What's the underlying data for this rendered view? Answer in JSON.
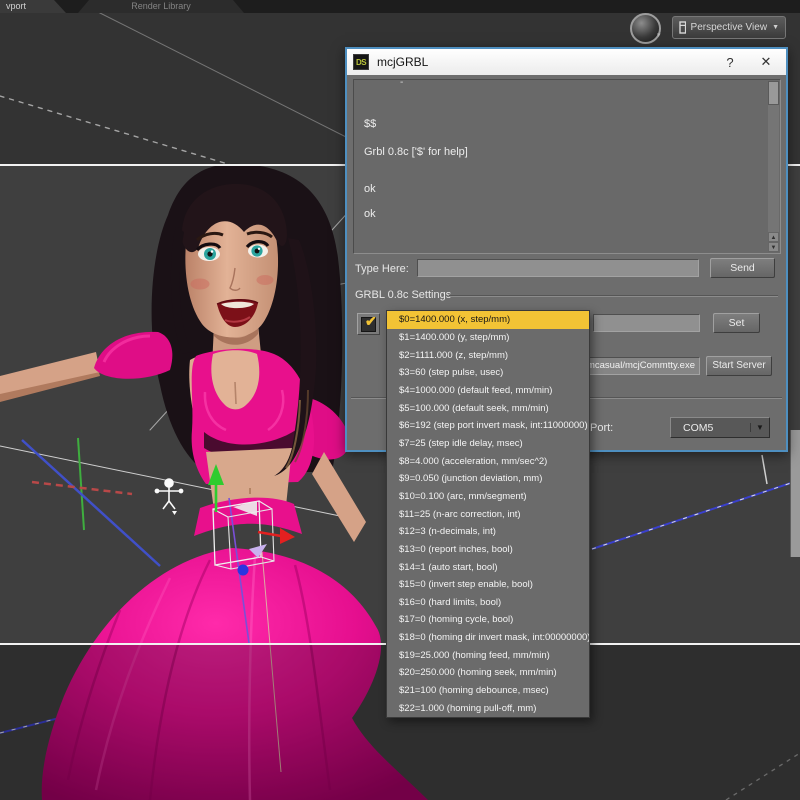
{
  "window": {
    "tabs": [
      {
        "label": "vport",
        "active": true
      },
      {
        "label": "Render Library",
        "active": false
      }
    ],
    "view_selector": {
      "label": "Perspective View",
      "arrow": "▼"
    },
    "magnifier_arrow": "▾"
  },
  "dialog": {
    "logo": "DS",
    "title": "mcjGRBL",
    "help": "?",
    "close": "✕",
    "console": {
      "partial_line": "-",
      "lines": [
        "$$",
        "Grbl 0.8c ['$' for help]",
        "ok",
        "ok"
      ]
    },
    "scrollbar": {
      "up": "▲",
      "down": "▼"
    },
    "prompt": {
      "label": "Type Here:",
      "value": "",
      "send": "Send"
    },
    "settings_group": {
      "label": "GRBL 0.8c Settings",
      "checkbox_check": "✔",
      "value_field": "",
      "set": "Set",
      "server_path": "/mcasual/mcjCommtty.exe",
      "start_server": "Start Server",
      "port_label": "Port:",
      "port_value": "COM5",
      "port_arrow": "▼"
    }
  },
  "settings_dropdown": {
    "selected_index": 0,
    "items": [
      "$0=1400.000 (x, step/mm)",
      "$1=1400.000 (y, step/mm)",
      "$2=1111.000 (z, step/mm)",
      "$3=60 (step pulse, usec)",
      "$4=1000.000 (default feed, mm/min)",
      "$5=100.000 (default seek, mm/min)",
      "$6=192 (step port invert mask, int:11000000)",
      "$7=25 (step idle delay, msec)",
      "$8=4.000 (acceleration, mm/sec^2)",
      "$9=0.050 (junction deviation, mm)",
      "$10=0.100 (arc, mm/segment)",
      "$11=25 (n-arc correction, int)",
      "$12=3 (n-decimals, int)",
      "$13=0 (report inches, bool)",
      "$14=1 (auto start, bool)",
      "$15=0 (invert step enable, bool)",
      "$16=0 (hard limits, bool)",
      "$17=0 (homing cycle, bool)",
      "$18=0 (homing dir invert mask, int:00000000)",
      "$19=25.000 (homing feed, mm/min)",
      "$20=250.000 (homing seek, mm/min)",
      "$21=100 (homing debounce, msec)",
      "$22=1.000 (homing pull-off, mm)"
    ]
  },
  "colors": {
    "dialog_border": "#4E8FC0",
    "selection_yellow": "#F2C335",
    "dress_pink": "#E8108C",
    "viewport_gray": "#3F3F3F",
    "frame_line": "#F2F2F2"
  }
}
